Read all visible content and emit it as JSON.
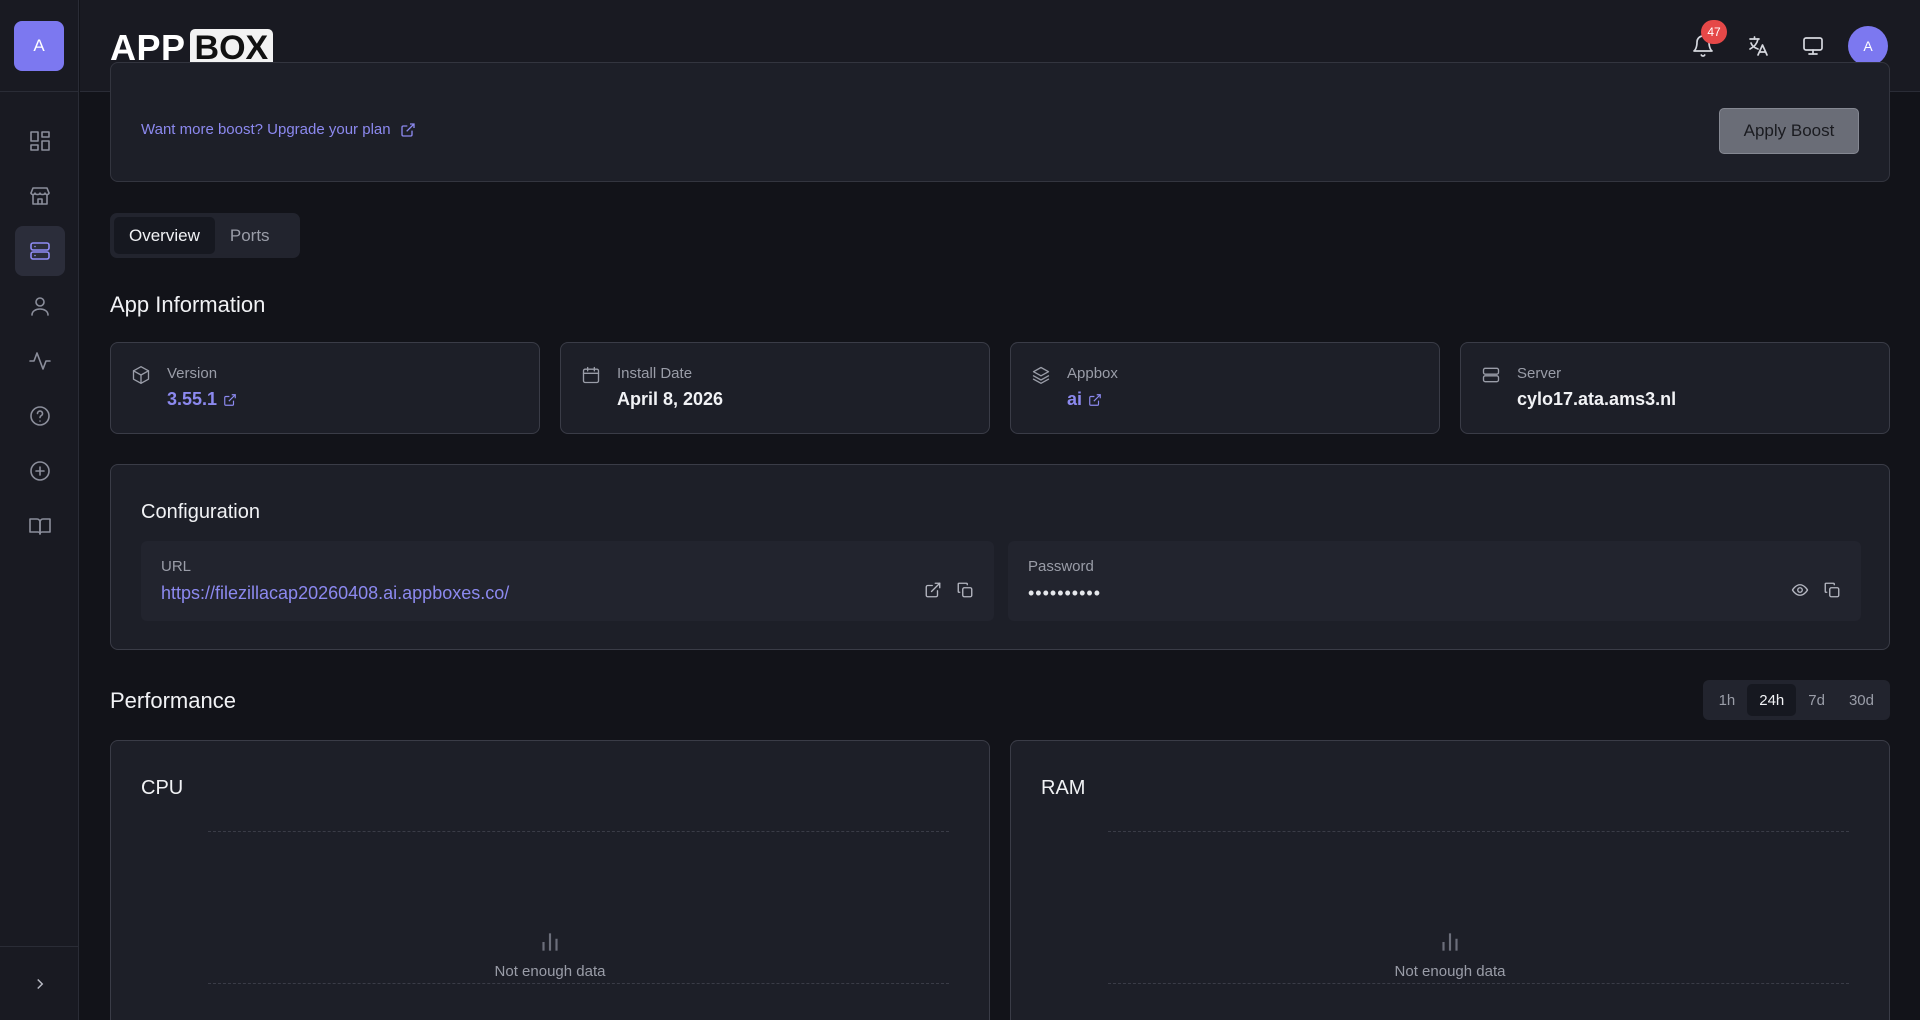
{
  "sidebar": {
    "avatar_initial": "A",
    "items": [
      {
        "icon": "dashboard-icon"
      },
      {
        "icon": "store-icon"
      },
      {
        "icon": "server-icon",
        "active": true
      },
      {
        "icon": "user-icon"
      },
      {
        "icon": "activity-icon"
      },
      {
        "icon": "help-icon"
      },
      {
        "icon": "add-circle-icon"
      },
      {
        "icon": "book-icon"
      }
    ],
    "collapse_icon": "chevron-right-icon"
  },
  "header": {
    "logo_app": "APP",
    "logo_box": "BOX",
    "notification_count": "47",
    "avatar_initial": "A"
  },
  "boost": {
    "link_text": "Want more boost? Upgrade your plan",
    "apply_label": "Apply Boost"
  },
  "tabs": [
    "Overview",
    "Ports"
  ],
  "app_info": {
    "title": "App Information",
    "cards": [
      {
        "label": "Version",
        "value": "3.55.1",
        "icon": "package-icon"
      },
      {
        "label": "Install Date",
        "value": "April 8, 2026",
        "icon": "calendar-icon"
      },
      {
        "label": "Appbox",
        "value": "ai",
        "icon": "layers-icon"
      },
      {
        "label": "Server",
        "value": "cylo17.ata.ams3.nl",
        "icon": "server-icon"
      }
    ]
  },
  "configuration": {
    "title": "Configuration",
    "url_label": "URL",
    "url_value": "https://filezillacap20260408.ai.appboxes.co/",
    "password_label": "Password",
    "password_value": "••••••••••"
  },
  "performance": {
    "title": "Performance",
    "ranges": [
      "1h",
      "24h",
      "7d",
      "30d"
    ],
    "active_range": "24h",
    "cpu_title": "CPU",
    "ram_title": "RAM",
    "empty_text": "Not enough data"
  },
  "colors": {
    "accent": "#8c89ef",
    "avatar": "#7c78f0",
    "badge": "#e54848"
  }
}
